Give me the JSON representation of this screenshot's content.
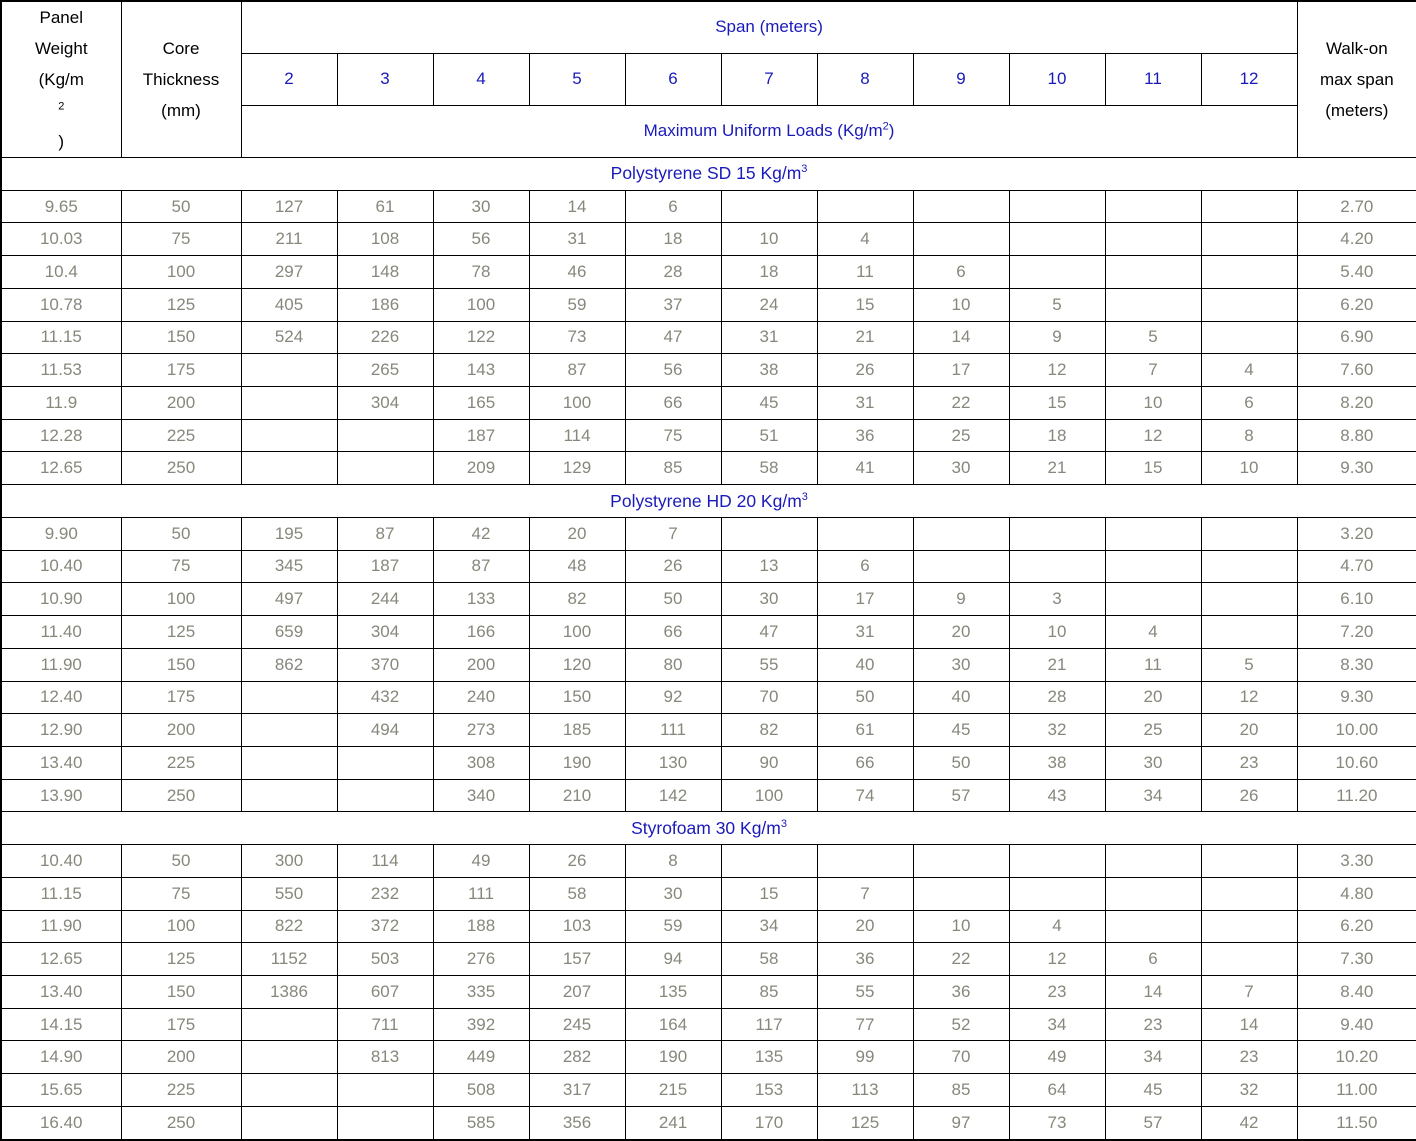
{
  "table": {
    "headers": {
      "panel_weight": [
        "Panel",
        "Weight",
        "(Kg/m2)"
      ],
      "panel_weight_line1": "Panel",
      "panel_weight_line2": "Weight",
      "panel_weight_line3_pre": "(Kg/m",
      "panel_weight_line3_sup": "2",
      "panel_weight_line3_post": ")",
      "core_thickness_line1": "Core",
      "core_thickness_line2": "Thickness",
      "core_thickness_line3": "(mm)",
      "span_title": "Span (meters)",
      "max_uniform_loads_pre": "Maximum Uniform Loads (Kg/m",
      "max_uniform_loads_sup": "2",
      "max_uniform_loads_post": ")",
      "walkon_line1": "Walk-on",
      "walkon_line2": "max span",
      "walkon_line3": "(meters)",
      "span_columns": [
        "2",
        "3",
        "4",
        "5",
        "6",
        "7",
        "8",
        "9",
        "10",
        "11",
        "12"
      ]
    },
    "colors": {
      "header_text": "#1a1aba",
      "data_text": "#87877c",
      "border": "#000000",
      "background": "#ffffff"
    },
    "sections": [
      {
        "label_pre": "Polystyrene SD 15 Kg/m",
        "label_sup": "3",
        "label": "Polystyrene SD 15 Kg/m3",
        "thick_after_row_index": 3,
        "rows": [
          {
            "weight": "9.65",
            "thickness": "50",
            "loads": [
              "127",
              "61",
              "30",
              "14",
              "6",
              "",
              "",
              "",
              "",
              "",
              ""
            ],
            "walkon": "2.70"
          },
          {
            "weight": "10.03",
            "thickness": "75",
            "loads": [
              "211",
              "108",
              "56",
              "31",
              "18",
              "10",
              "4",
              "",
              "",
              "",
              ""
            ],
            "walkon": "4.20"
          },
          {
            "weight": "10.4",
            "thickness": "100",
            "loads": [
              "297",
              "148",
              "78",
              "46",
              "28",
              "18",
              "11",
              "6",
              "",
              "",
              ""
            ],
            "walkon": "5.40"
          },
          {
            "weight": "10.78",
            "thickness": "125",
            "loads": [
              "405",
              "186",
              "100",
              "59",
              "37",
              "24",
              "15",
              "10",
              "5",
              "",
              ""
            ],
            "walkon": "6.20"
          },
          {
            "weight": "11.15",
            "thickness": "150",
            "loads": [
              "524",
              "226",
              "122",
              "73",
              "47",
              "31",
              "21",
              "14",
              "9",
              "5",
              ""
            ],
            "walkon": "6.90"
          },
          {
            "weight": "11.53",
            "thickness": "175",
            "loads": [
              "",
              "265",
              "143",
              "87",
              "56",
              "38",
              "26",
              "17",
              "12",
              "7",
              "4"
            ],
            "walkon": "7.60"
          },
          {
            "weight": "11.9",
            "thickness": "200",
            "loads": [
              "",
              "304",
              "165",
              "100",
              "66",
              "45",
              "31",
              "22",
              "15",
              "10",
              "6"
            ],
            "walkon": "8.20"
          },
          {
            "weight": "12.28",
            "thickness": "225",
            "loads": [
              "",
              "",
              "187",
              "114",
              "75",
              "51",
              "36",
              "25",
              "18",
              "12",
              "8"
            ],
            "walkon": "8.80"
          },
          {
            "weight": "12.65",
            "thickness": "250",
            "loads": [
              "",
              "",
              "209",
              "129",
              "85",
              "58",
              "41",
              "30",
              "21",
              "15",
              "10"
            ],
            "walkon": "9.30"
          }
        ]
      },
      {
        "label_pre": "Polystyrene HD 20 Kg/m",
        "label_sup": "3",
        "label": "Polystyrene HD 20 Kg/m3",
        "thick_after_row_index": -1,
        "rows": [
          {
            "weight": "9.90",
            "thickness": "50",
            "loads": [
              "195",
              "87",
              "42",
              "20",
              "7",
              "",
              "",
              "",
              "",
              "",
              ""
            ],
            "walkon": "3.20"
          },
          {
            "weight": "10.40",
            "thickness": "75",
            "loads": [
              "345",
              "187",
              "87",
              "48",
              "26",
              "13",
              "6",
              "",
              "",
              "",
              ""
            ],
            "walkon": "4.70"
          },
          {
            "weight": "10.90",
            "thickness": "100",
            "loads": [
              "497",
              "244",
              "133",
              "82",
              "50",
              "30",
              "17",
              "9",
              "3",
              "",
              ""
            ],
            "walkon": "6.10"
          },
          {
            "weight": "11.40",
            "thickness": "125",
            "loads": [
              "659",
              "304",
              "166",
              "100",
              "66",
              "47",
              "31",
              "20",
              "10",
              "4",
              ""
            ],
            "walkon": "7.20"
          },
          {
            "weight": "11.90",
            "thickness": "150",
            "loads": [
              "862",
              "370",
              "200",
              "120",
              "80",
              "55",
              "40",
              "30",
              "21",
              "11",
              "5"
            ],
            "walkon": "8.30"
          },
          {
            "weight": "12.40",
            "thickness": "175",
            "loads": [
              "",
              "432",
              "240",
              "150",
              "92",
              "70",
              "50",
              "40",
              "28",
              "20",
              "12"
            ],
            "walkon": "9.30"
          },
          {
            "weight": "12.90",
            "thickness": "200",
            "loads": [
              "",
              "494",
              "273",
              "185",
              "111",
              "82",
              "61",
              "45",
              "32",
              "25",
              "20"
            ],
            "walkon": "10.00"
          },
          {
            "weight": "13.40",
            "thickness": "225",
            "loads": [
              "",
              "",
              "308",
              "190",
              "130",
              "90",
              "66",
              "50",
              "38",
              "30",
              "23"
            ],
            "walkon": "10.60"
          },
          {
            "weight": "13.90",
            "thickness": "250",
            "loads": [
              "",
              "",
              "340",
              "210",
              "142",
              "100",
              "74",
              "57",
              "43",
              "34",
              "26"
            ],
            "walkon": "11.20"
          }
        ]
      },
      {
        "label_pre": "Styrofoam 30 Kg/m",
        "label_sup": "3",
        "label": "Styrofoam 30 Kg/m3",
        "thick_after_row_index": 0,
        "rows": [
          {
            "weight": "10.40",
            "thickness": "50",
            "loads": [
              "300",
              "114",
              "49",
              "26",
              "8",
              "",
              "",
              "",
              "",
              "",
              ""
            ],
            "walkon": "3.30"
          },
          {
            "weight": "11.15",
            "thickness": "75",
            "loads": [
              "550",
              "232",
              "111",
              "58",
              "30",
              "15",
              "7",
              "",
              "",
              "",
              ""
            ],
            "walkon": "4.80"
          },
          {
            "weight": "11.90",
            "thickness": "100",
            "loads": [
              "822",
              "372",
              "188",
              "103",
              "59",
              "34",
              "20",
              "10",
              "4",
              "",
              ""
            ],
            "walkon": "6.20"
          },
          {
            "weight": "12.65",
            "thickness": "125",
            "loads": [
              "1152",
              "503",
              "276",
              "157",
              "94",
              "58",
              "36",
              "22",
              "12",
              "6",
              ""
            ],
            "walkon": "7.30"
          },
          {
            "weight": "13.40",
            "thickness": "150",
            "loads": [
              "1386",
              "607",
              "335",
              "207",
              "135",
              "85",
              "55",
              "36",
              "23",
              "14",
              "7"
            ],
            "walkon": "8.40"
          },
          {
            "weight": "14.15",
            "thickness": "175",
            "loads": [
              "",
              "711",
              "392",
              "245",
              "164",
              "117",
              "77",
              "52",
              "34",
              "23",
              "14"
            ],
            "walkon": "9.40"
          },
          {
            "weight": "14.90",
            "thickness": "200",
            "loads": [
              "",
              "813",
              "449",
              "282",
              "190",
              "135",
              "99",
              "70",
              "49",
              "34",
              "23"
            ],
            "walkon": "10.20"
          },
          {
            "weight": "15.65",
            "thickness": "225",
            "loads": [
              "",
              "",
              "508",
              "317",
              "215",
              "153",
              "113",
              "85",
              "64",
              "45",
              "32"
            ],
            "walkon": "11.00"
          },
          {
            "weight": "16.40",
            "thickness": "250",
            "loads": [
              "",
              "",
              "585",
              "356",
              "241",
              "170",
              "125",
              "97",
              "73",
              "57",
              "42"
            ],
            "walkon": "11.50"
          }
        ]
      }
    ]
  }
}
